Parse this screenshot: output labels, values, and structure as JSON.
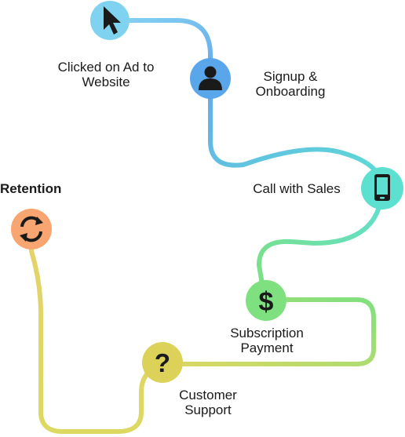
{
  "diagram": {
    "stages": [
      {
        "id": "ad-click",
        "label": "Clicked on Ad to\nWebsite",
        "icon": "cursor-icon",
        "color": "#7fd3f0"
      },
      {
        "id": "signup",
        "label": "Signup &\nOnboarding",
        "icon": "user-icon",
        "color": "#5aa6ea"
      },
      {
        "id": "sales-call",
        "label": "Call with Sales",
        "icon": "phone-icon",
        "color": "#5ee0d0"
      },
      {
        "id": "payment",
        "label": "Subscription\nPayment",
        "icon": "dollar-icon",
        "color": "#7ee07e"
      },
      {
        "id": "support",
        "label": "Customer\nSupport",
        "icon": "question-icon",
        "color": "#dcd25a"
      },
      {
        "id": "retention",
        "label": "Retention",
        "icon": "refresh-icon",
        "color": "#f8a571"
      }
    ],
    "path_colors": {
      "ad_to_signup": "#86d3f2",
      "signup_to_sales": "#64a9ec",
      "sales_to_payment": "#5ddfd3",
      "payment_to_support": "#7fe07e",
      "support_to_retention": "#dcd862"
    },
    "icon_glyph_color": "#1a1a1a"
  }
}
